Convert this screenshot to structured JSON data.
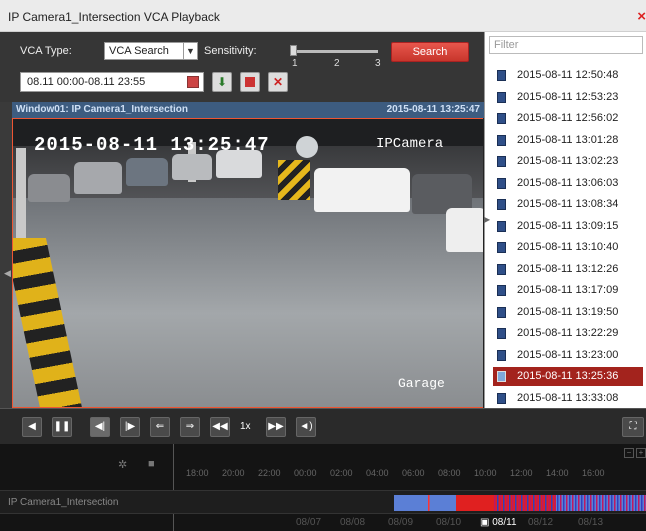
{
  "window": {
    "title": "IP Camera1_Intersection VCA Playback",
    "close": "×"
  },
  "toolbar": {
    "vca_type_label": "VCA Type:",
    "vca_type_value": "VCA Search",
    "sensitivity_label": "Sensitivity:",
    "sensitivity_ticks": [
      "1",
      "2",
      "3"
    ],
    "sensitivity_level": 1,
    "search_label": "Search",
    "datetime_range": "08.11 00:00-08.11 23:55"
  },
  "video": {
    "header_left": "Window01: IP Camera1_Intersection",
    "header_right": "2015-08-11 13:25:47",
    "osd_time": "2015-08-11 13:25:47",
    "osd_camera": "IPCamera",
    "osd_location": "Garage"
  },
  "panel": {
    "filter_placeholder": "Filter",
    "records": [
      "2015-08-11 12:50:48",
      "2015-08-11 12:53:23",
      "2015-08-11 12:56:02",
      "2015-08-11 13:01:28",
      "2015-08-11 13:02:23",
      "2015-08-11 13:06:03",
      "2015-08-11 13:08:34",
      "2015-08-11 13:09:15",
      "2015-08-11 13:10:40",
      "2015-08-11 13:12:26",
      "2015-08-11 13:17:09",
      "2015-08-11 13:19:50",
      "2015-08-11 13:22:29",
      "2015-08-11 13:23:00",
      "2015-08-11 13:25:36",
      "2015-08-11 13:33:08"
    ],
    "selected_index": 14
  },
  "playback": {
    "speed": "1x"
  },
  "timeline": {
    "ticks": [
      "18:00",
      "20:00",
      "22:00",
      "00:00",
      "02:00",
      "04:00",
      "06:00",
      "08:00",
      "10:00",
      "12:00",
      "14:00",
      "16:00"
    ],
    "camera_name": "IP Camera1_Intersection",
    "dates": [
      "08/07",
      "08/08",
      "08/09",
      "08/10",
      "08/11",
      "08/12",
      "08/13"
    ],
    "current_date": "08/11"
  },
  "colors": {
    "accent_red": "#a3231d",
    "header_blue": "#3d5c80",
    "record_blue": "#5b7fd6",
    "event_red": "#e02020"
  }
}
